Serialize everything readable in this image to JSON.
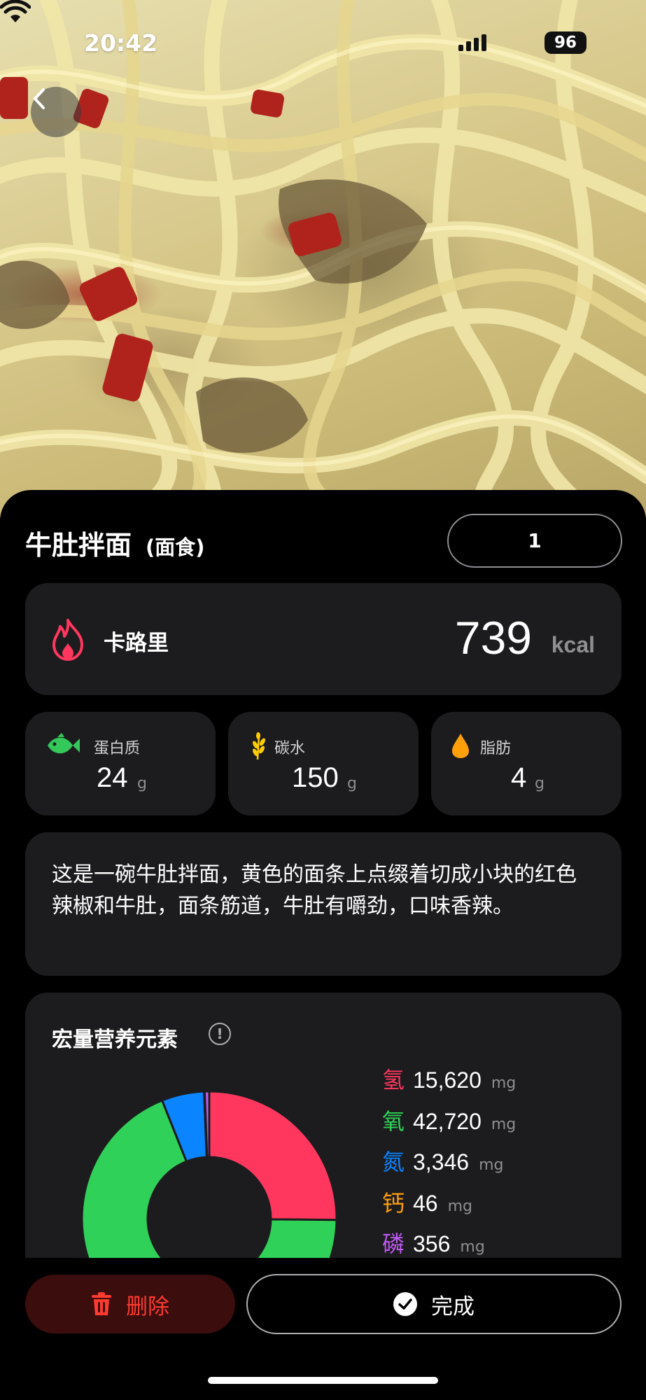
{
  "status_bar": {
    "time": "20:42",
    "battery": "96"
  },
  "food": {
    "name": "牛肚拌面",
    "category": "(面食)",
    "quantity": "1"
  },
  "calories": {
    "label": "卡路里",
    "value": "739",
    "unit": "kcal"
  },
  "macros": [
    {
      "label": "蛋白质",
      "value": "24",
      "unit": "g",
      "icon": "fish-icon",
      "color": "#34c759"
    },
    {
      "label": "碳水",
      "value": "150",
      "unit": "g",
      "icon": "wheat-icon",
      "color": "#ffcc00"
    },
    {
      "label": "脂肪",
      "value": "4",
      "unit": "g",
      "icon": "drop-icon",
      "color": "#ff9500"
    }
  ],
  "description": "这是一碗牛肚拌面，黄色的面条上点缀着切成小块的红色辣椒和牛肚，面条筋道，牛肚有嚼劲，口味香辣。",
  "elements_section": {
    "title": "宏量营养元素",
    "items": [
      {
        "symbol": "氢",
        "value": "15,620",
        "unit": "mg",
        "color": "#ff375f"
      },
      {
        "symbol": "氧",
        "value": "42,720",
        "unit": "mg",
        "color": "#30d158"
      },
      {
        "symbol": "氮",
        "value": "3,346",
        "unit": "mg",
        "color": "#0a84ff"
      },
      {
        "symbol": "钙",
        "value": "46",
        "unit": "mg",
        "color": "#ff9f0a"
      },
      {
        "symbol": "磷",
        "value": "356",
        "unit": "mg",
        "color": "#bf5af2"
      }
    ]
  },
  "actions": {
    "delete_label": "删除",
    "done_label": "完成"
  }
}
